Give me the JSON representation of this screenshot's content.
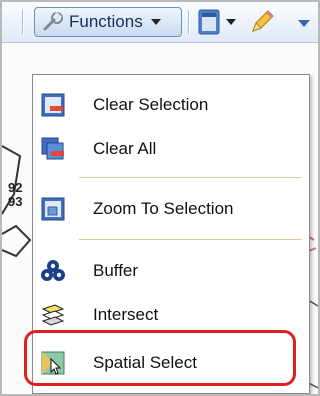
{
  "toolbar": {
    "functions_label": "Functions"
  },
  "menu": {
    "items": [
      {
        "label": "Clear Selection",
        "icon": "clear-selection-icon"
      },
      {
        "label": "Clear All",
        "icon": "clear-all-icon"
      },
      {
        "label": "Zoom To Selection",
        "icon": "zoom-to-selection-icon"
      },
      {
        "label": "Buffer",
        "icon": "buffer-icon"
      },
      {
        "label": "Intersect",
        "icon": "intersect-icon"
      },
      {
        "label": "Spatial Select",
        "icon": "spatial-select-icon"
      }
    ]
  },
  "map": {
    "labels": [
      "92",
      "93"
    ]
  },
  "colors": {
    "highlight": "#e02020",
    "toolbar_border": "#6f8fb8",
    "menu_separator": "#e0c79a"
  }
}
